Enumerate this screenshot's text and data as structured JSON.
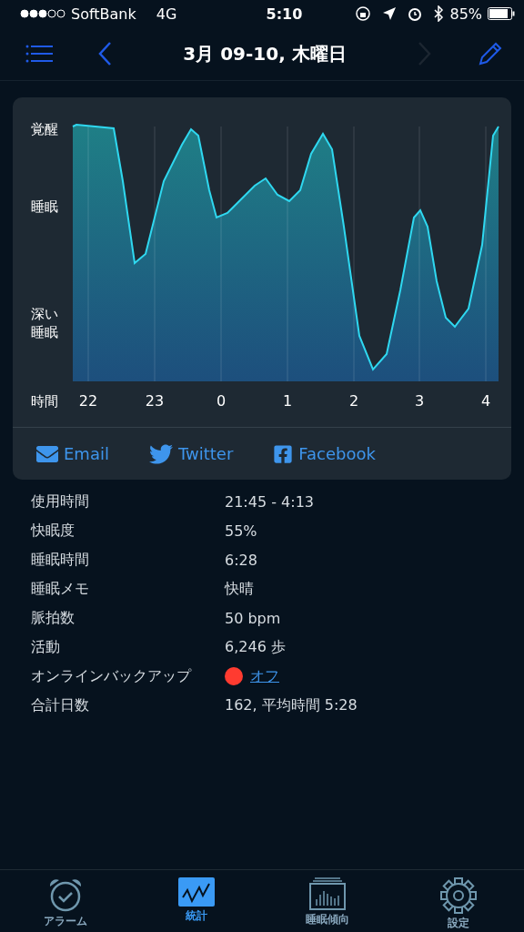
{
  "status_bar": {
    "carrier": "SoftBank",
    "network": "4G",
    "time": "5:10",
    "battery": "85%"
  },
  "nav": {
    "title": "3月 09-10, 木曜日",
    "next_disabled": true
  },
  "chart": {
    "y_labels": [
      {
        "lines": [
          "覚醒"
        ]
      },
      {
        "lines": [
          "睡眠"
        ]
      },
      {
        "lines": [
          "深い",
          "睡眠"
        ]
      }
    ],
    "x_title": "時間",
    "x_ticks": [
      "22",
      "23",
      "0",
      "1",
      "2",
      "3",
      "4"
    ]
  },
  "share": [
    {
      "kind": "email",
      "label": "Email"
    },
    {
      "kind": "twitter",
      "label": "Twitter"
    },
    {
      "kind": "facebook",
      "label": "Facebook"
    }
  ],
  "stats": [
    {
      "kind": "text",
      "label": "使用時間",
      "value": "21:45 - 4:13"
    },
    {
      "kind": "text",
      "label": "快眠度",
      "value": "55%"
    },
    {
      "kind": "text",
      "label": "睡眠時間",
      "value": "6:28"
    },
    {
      "kind": "text",
      "label": "睡眠メモ",
      "value": "快晴"
    },
    {
      "kind": "text",
      "label": "脈拍数",
      "value": "50 bpm"
    },
    {
      "kind": "text",
      "label": "活動",
      "value": "6,246 歩"
    },
    {
      "kind": "status",
      "label": "オンラインバックアップ",
      "value": "オフ",
      "color": "#ff3b30"
    },
    {
      "kind": "text",
      "label": "合計日数",
      "value": "162, 平均時間 5:28"
    }
  ],
  "tabs": [
    {
      "kind": "alarm",
      "label": "アラーム",
      "selected": false
    },
    {
      "kind": "stats",
      "label": "統計",
      "selected": true
    },
    {
      "kind": "trend",
      "label": "睡眠傾向",
      "selected": false
    },
    {
      "kind": "settings",
      "label": "設定",
      "selected": false
    }
  ]
}
